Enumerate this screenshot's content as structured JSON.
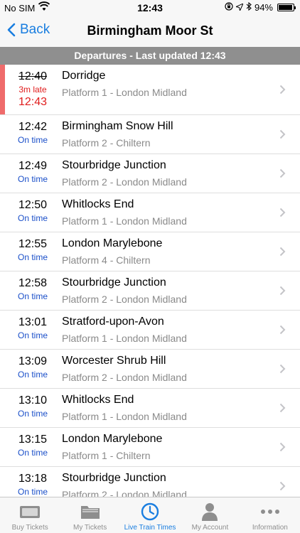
{
  "status_bar": {
    "carrier": "No SIM",
    "time": "12:43",
    "battery": "94%",
    "battery_level": 0.94
  },
  "nav": {
    "back_label": "Back",
    "title": "Birmingham Moor St"
  },
  "section_header": "Departures - Last updated 12:43",
  "departures": [
    {
      "time": "12:40",
      "status": "3m late",
      "actual": "12:43",
      "late": true,
      "destination": "Dorridge",
      "platform": "Platform 1 - London Midland"
    },
    {
      "time": "12:42",
      "status": "On time",
      "late": false,
      "destination": "Birmingham Snow Hill",
      "platform": "Platform 2 - Chiltern"
    },
    {
      "time": "12:49",
      "status": "On time",
      "late": false,
      "destination": "Stourbridge Junction",
      "platform": "Platform 2 - London Midland"
    },
    {
      "time": "12:50",
      "status": "On time",
      "late": false,
      "destination": "Whitlocks End",
      "platform": "Platform 1 - London Midland"
    },
    {
      "time": "12:55",
      "status": "On time",
      "late": false,
      "destination": "London Marylebone",
      "platform": "Platform 4 - Chiltern"
    },
    {
      "time": "12:58",
      "status": "On time",
      "late": false,
      "destination": "Stourbridge Junction",
      "platform": "Platform 2 - London Midland"
    },
    {
      "time": "13:01",
      "status": "On time",
      "late": false,
      "destination": "Stratford-upon-Avon",
      "platform": "Platform 1 - London Midland"
    },
    {
      "time": "13:09",
      "status": "On time",
      "late": false,
      "destination": "Worcester Shrub Hill",
      "platform": "Platform 2 - London Midland"
    },
    {
      "time": "13:10",
      "status": "On time",
      "late": false,
      "destination": "Whitlocks End",
      "platform": "Platform 1 - London Midland"
    },
    {
      "time": "13:15",
      "status": "On time",
      "late": false,
      "destination": "London Marylebone",
      "platform": "Platform 1 - Chiltern"
    },
    {
      "time": "13:18",
      "status": "On time",
      "late": false,
      "destination": "Stourbridge Junction",
      "platform": "Platform 2 - London Midland"
    }
  ],
  "tabs": [
    {
      "label": "Buy Tickets",
      "icon": "ticket-icon",
      "active": false
    },
    {
      "label": "My Tickets",
      "icon": "folder-icon",
      "active": false
    },
    {
      "label": "Live Train Times",
      "icon": "clock-icon",
      "active": true
    },
    {
      "label": "My Account",
      "icon": "person-icon",
      "active": false
    },
    {
      "label": "Information",
      "icon": "more-icon",
      "active": false
    }
  ],
  "colors": {
    "accent": "#1a7ee0",
    "late": "#e01c1c",
    "late_bar": "#ef6b6b",
    "on_time": "#1a4fc9"
  }
}
